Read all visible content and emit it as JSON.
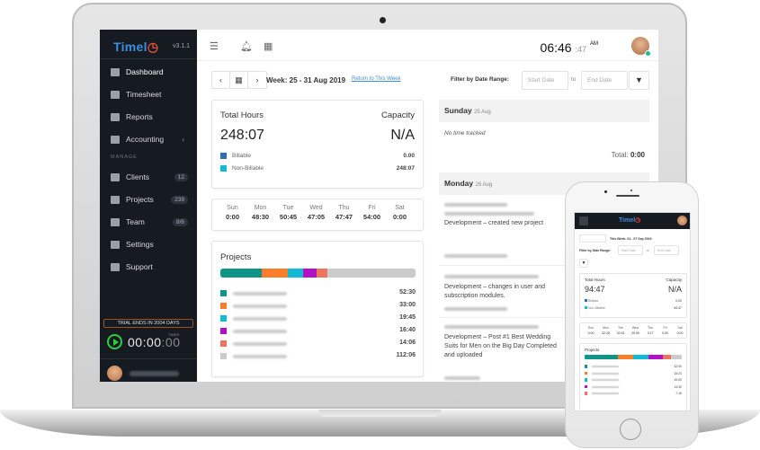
{
  "app": {
    "brand": "Timel",
    "version": "v3.1.1"
  },
  "sidebar": {
    "items": [
      {
        "label": "Dashboard",
        "icon": "dashboard-icon"
      },
      {
        "label": "Timesheet",
        "icon": "timesheet-icon"
      },
      {
        "label": "Reports",
        "icon": "reports-icon"
      },
      {
        "label": "Accounting",
        "icon": "accounting-icon",
        "chevron": "‹"
      }
    ],
    "section_label": "MANAGE",
    "manage_items": [
      {
        "label": "Clients",
        "icon": "clients-icon",
        "badge": "12"
      },
      {
        "label": "Projects",
        "icon": "projects-icon",
        "badge": "239"
      },
      {
        "label": "Team",
        "icon": "team-icon",
        "badge": "8/6"
      },
      {
        "label": "Settings",
        "icon": "settings-icon"
      },
      {
        "label": "Support",
        "icon": "support-icon"
      }
    ],
    "trial_text": "TRIAL ENDS IN 2004 DAYS",
    "timer": {
      "label": "TIMER",
      "hm": "00:00",
      "sec": ":00"
    }
  },
  "topbar": {
    "clock_hm": "06:46",
    "clock_sec": ":47",
    "clock_ampm": "AM"
  },
  "toolbar": {
    "prev": "‹",
    "calendar": "▦",
    "next": "›",
    "week_label": "Week: 25 - 31 Aug 2019",
    "return_link": "Return to This Week",
    "filter_label": "Filter by Date Range:",
    "start_placeholder": "Start Date",
    "to": "to",
    "end_placeholder": "End Date",
    "filter_icon": "▼"
  },
  "summary": {
    "total_label": "Total Hours",
    "total_value": "248:07",
    "capacity_label": "Capacity",
    "capacity_value": "N/A",
    "billable_label": "Billable",
    "billable_value": "0.00",
    "billable_color": "#2f6eb5",
    "nonbillable_label": "Non-Billable",
    "nonbillable_value": "248:07",
    "nonbillable_color": "#10bcd4"
  },
  "days": [
    {
      "name": "Sun",
      "value": "0:00"
    },
    {
      "name": "Mon",
      "value": "48:30"
    },
    {
      "name": "Tue",
      "value": "50:45"
    },
    {
      "name": "Wed",
      "value": "47:05"
    },
    {
      "name": "Thu",
      "value": "47:47"
    },
    {
      "name": "Fri",
      "value": "54:00"
    },
    {
      "name": "Sat",
      "value": "0:00"
    }
  ],
  "projects": {
    "title": "Projects",
    "items": [
      {
        "time": "52:30",
        "color": "#0f9488",
        "share": 0.212
      },
      {
        "time": "33:00",
        "color": "#fb7d2a",
        "share": 0.133
      },
      {
        "time": "19:45",
        "color": "#10bcd4",
        "share": 0.08
      },
      {
        "time": "16:40",
        "color": "#b20fc8",
        "share": 0.067
      },
      {
        "time": "14:06",
        "color": "#ee7462",
        "share": 0.057
      },
      {
        "time": "112:06",
        "color": "#cbcbcb",
        "share": 0.451
      }
    ]
  },
  "timeline": {
    "sunday": {
      "day": "Sunday",
      "date": "25 Aug",
      "empty": "No time tracked",
      "total_label": "Total:",
      "total_value": "0:00"
    },
    "monday": {
      "day": "Monday",
      "date": "26 Aug"
    },
    "entries": [
      {
        "text": "Development  –  created new project"
      },
      {
        "text": "Development  –  changes in user and subscription modules."
      },
      {
        "text": "Development  –  Post #1 Best Wedding Suits for Men on the Big Day Completed and uploaded"
      }
    ]
  },
  "phone": {
    "week_label": "This Week: 01 - 07 Sep 2019",
    "filter_label": "Filter by Date Range:",
    "start_placeholder": "Start Date",
    "to": "to",
    "end_placeholder": "End Date",
    "total_label": "Total Hours",
    "total_value": "94:47",
    "capacity_label": "Capacity",
    "capacity_value": "N/A",
    "billable_label": "Billable",
    "billable_value": "0.00",
    "nonbillable_label": "Non-Billable",
    "nonbillable_value": "94:47",
    "days": [
      {
        "name": "Sun",
        "value": "0:00"
      },
      {
        "name": "Mon",
        "value": "32:28"
      },
      {
        "name": "Tue",
        "value": "32:53"
      },
      {
        "name": "Wed",
        "value": "25:59"
      },
      {
        "name": "Thu",
        "value": "3:27"
      },
      {
        "name": "Fri",
        "value": "0:00"
      },
      {
        "name": "Sat",
        "value": "0:00"
      }
    ],
    "projects_title": "Projects",
    "projects": [
      {
        "time": "32:00",
        "color": "#0f9488",
        "share": 0.34
      },
      {
        "time": "15:23",
        "color": "#fb7d2a",
        "share": 0.16
      },
      {
        "time": "15:00",
        "color": "#10bcd4",
        "share": 0.16
      },
      {
        "time": "14:30",
        "color": "#b20fc8",
        "share": 0.15
      },
      {
        "time": "7:16",
        "color": "#ee7462",
        "share": 0.08
      },
      {
        "time": "",
        "color": "#cbcbcb",
        "share": 0.11
      }
    ]
  }
}
